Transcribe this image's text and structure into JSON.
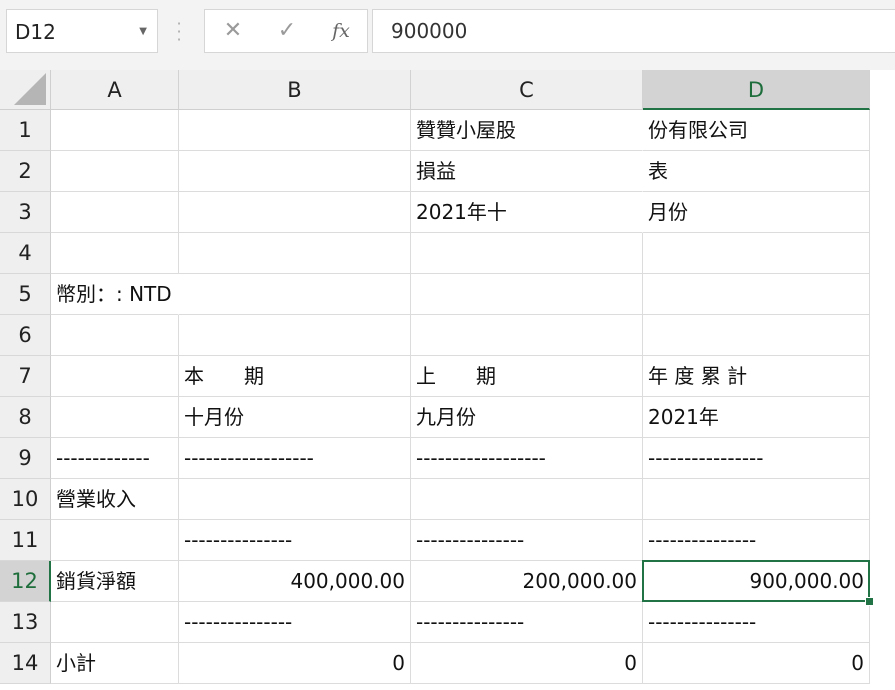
{
  "formula_bar": {
    "name_box": "D12",
    "cancel_icon": "✕",
    "enter_icon": "✓",
    "fx_label": "fx",
    "formula": "900000"
  },
  "columns": [
    "A",
    "B",
    "C",
    "D"
  ],
  "active_column": "D",
  "active_row": 12,
  "rows": [
    {
      "n": "1",
      "A": "",
      "B": "",
      "C": "贊贊小屋股",
      "D": "份有限公司"
    },
    {
      "n": "2",
      "A": "",
      "B": "",
      "C": "損益",
      "D": "表"
    },
    {
      "n": "3",
      "A": "",
      "B": "",
      "C": "2021年十",
      "D": "月份"
    },
    {
      "n": "4",
      "A": "",
      "B": "",
      "C": "",
      "D": ""
    },
    {
      "n": "5",
      "A": "幣別：: NTD",
      "B": "",
      "C": "",
      "D": ""
    },
    {
      "n": "6",
      "A": "",
      "B": "",
      "C": "",
      "D": ""
    },
    {
      "n": "7",
      "A": "",
      "B": "本　　期",
      "C": "上　　期",
      "D": "年 度 累 計"
    },
    {
      "n": "8",
      "A": "",
      "B": "十月份",
      "C": "九月份",
      "D": "2021年"
    },
    {
      "n": "9",
      "A": "-------------",
      "B": "------------------",
      "C": "------------------",
      "D": "----------------"
    },
    {
      "n": "10",
      "A": "營業收入",
      "B": "",
      "C": "",
      "D": ""
    },
    {
      "n": "11",
      "A": "",
      "B": "---------------",
      "C": "---------------",
      "D": "---------------"
    },
    {
      "n": "12",
      "A": "銷貨淨額",
      "B": "400,000.00",
      "C": "200,000.00",
      "D": "900,000.00"
    },
    {
      "n": "13",
      "A": "",
      "B": "---------------",
      "C": "---------------",
      "D": "---------------"
    },
    {
      "n": "14",
      "A": "小計",
      "B": "0",
      "C": "0",
      "D": "0"
    }
  ]
}
